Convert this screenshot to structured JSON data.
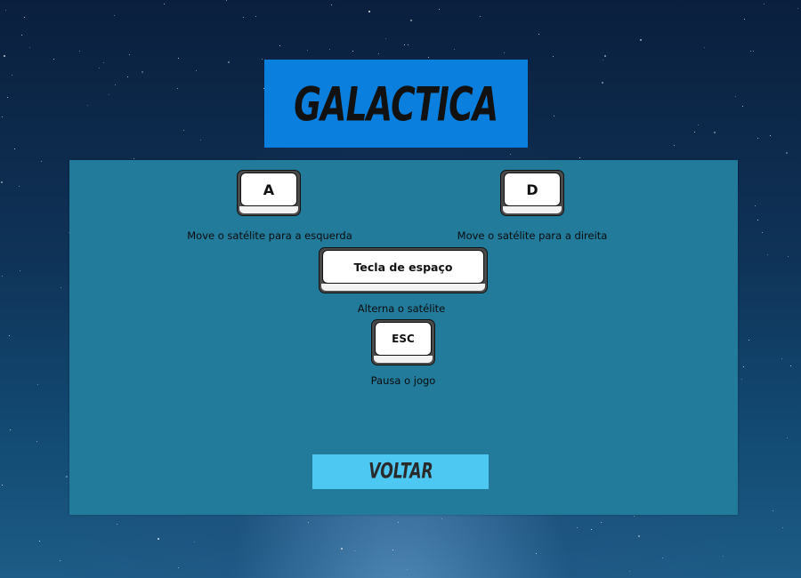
{
  "game": {
    "title": "GALACTICA"
  },
  "controls": [
    {
      "key": "A",
      "description": "Move o satélite para a esquerda"
    },
    {
      "key": "D",
      "description": "Move o satélite para a direita"
    },
    {
      "key": "Tecla de espaço",
      "description": "Alterna o satélite"
    },
    {
      "key": "ESC",
      "description": "Pausa o jogo"
    }
  ],
  "back_button": {
    "label": "VOLTAR"
  },
  "colors": {
    "title_bg": "#0a7fdd",
    "panel_bg": "#237b9b",
    "button_bg": "#4dc8f2",
    "key_face": "#ffffff"
  }
}
